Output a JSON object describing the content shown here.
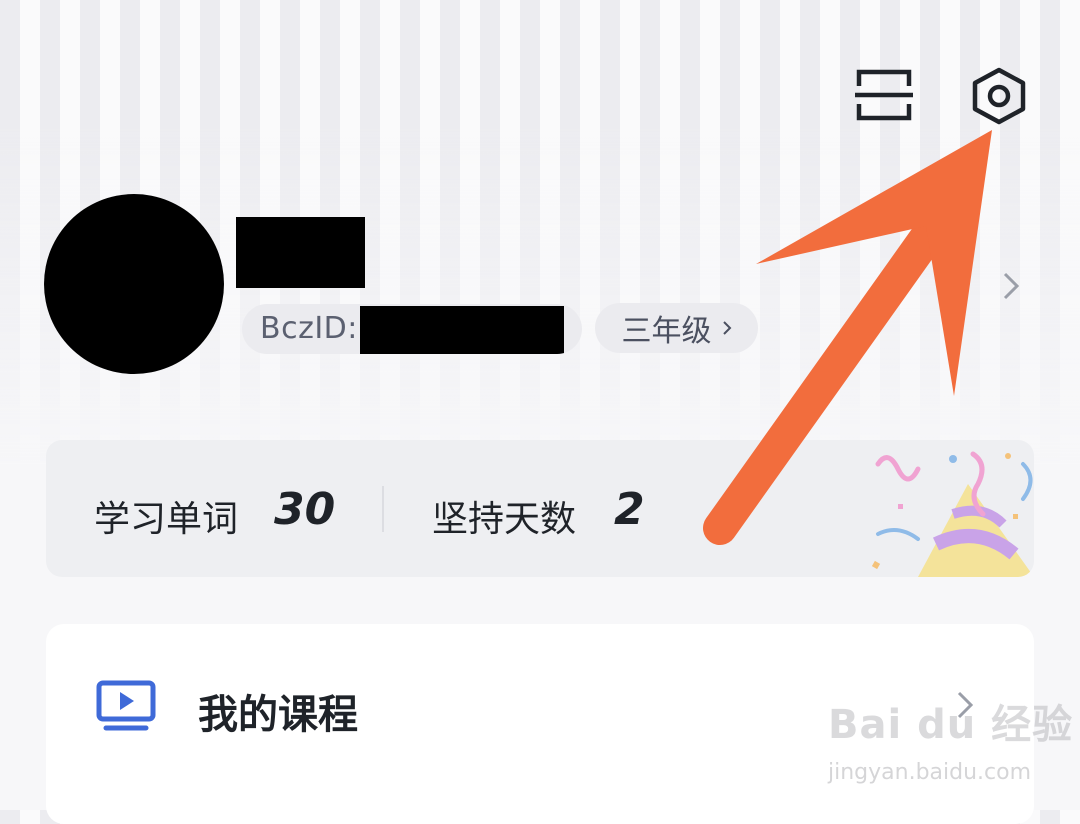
{
  "header": {
    "scan_icon": "scan-icon",
    "settings_icon": "settings-hexagon-icon"
  },
  "profile": {
    "id_label": "BczID:",
    "grade": "三年级"
  },
  "stats": {
    "words_label": "学习单词",
    "words_value": "30",
    "days_label": "坚持天数",
    "days_value": "2"
  },
  "courses": {
    "title": "我的课程"
  },
  "annotation": {
    "arrow_color": "#f26d3d"
  },
  "watermark": {
    "logo_text": "Bai du 经验",
    "url": "jingyan.baidu.com"
  }
}
